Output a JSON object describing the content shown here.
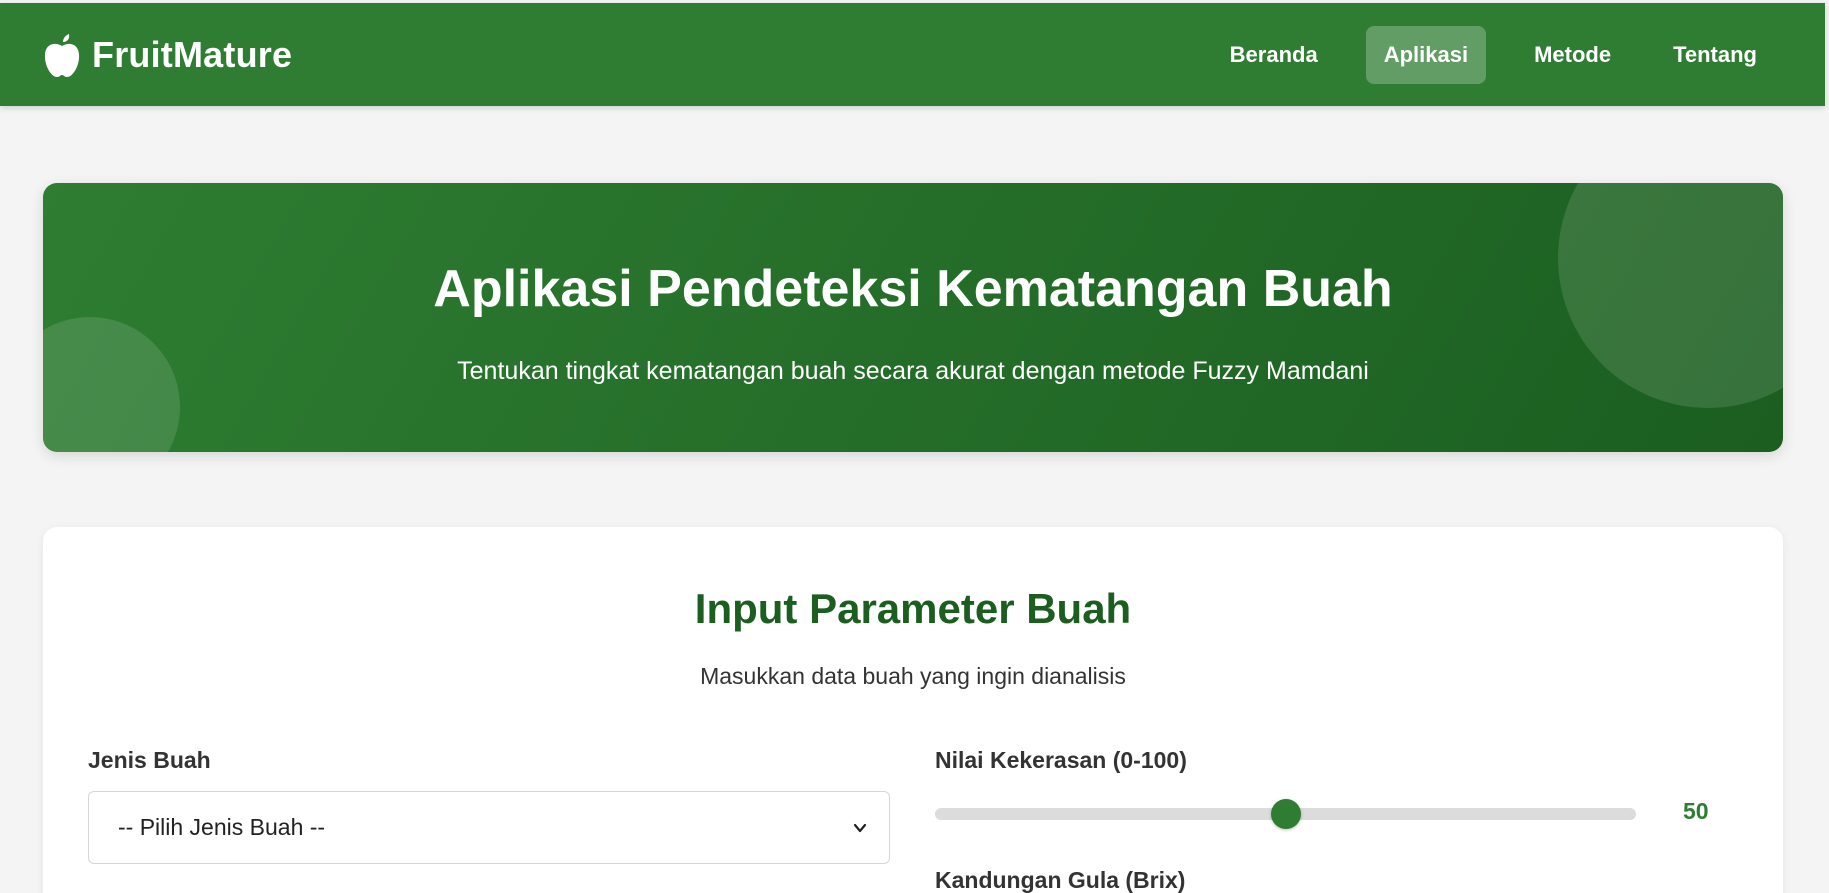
{
  "nav": {
    "brand": "FruitMature",
    "brand_icon": "apple-icon",
    "links": [
      {
        "label": "Beranda",
        "active": false
      },
      {
        "label": "Aplikasi",
        "active": true
      },
      {
        "label": "Metode",
        "active": false
      },
      {
        "label": "Tentang",
        "active": false
      }
    ]
  },
  "hero": {
    "title": "Aplikasi Pendeteksi Kematangan Buah",
    "subtitle": "Tentukan tingkat kematangan buah secara akurat dengan metode Fuzzy Mamdani"
  },
  "form": {
    "title": "Input Parameter Buah",
    "subtitle": "Masukkan data buah yang ingin dianalisis",
    "fruit_type": {
      "label": "Jenis Buah",
      "selected": "-- Pilih Jenis Buah --"
    },
    "hardness": {
      "label": "Nilai Kekerasan (0-100)",
      "value": 50,
      "min": 0,
      "max": 100
    },
    "sugar": {
      "label": "Kandungan Gula (Brix)"
    }
  },
  "colors": {
    "primary": "#2e7d32",
    "primary_dark": "#1b5e20",
    "background": "#f4f4f4"
  }
}
